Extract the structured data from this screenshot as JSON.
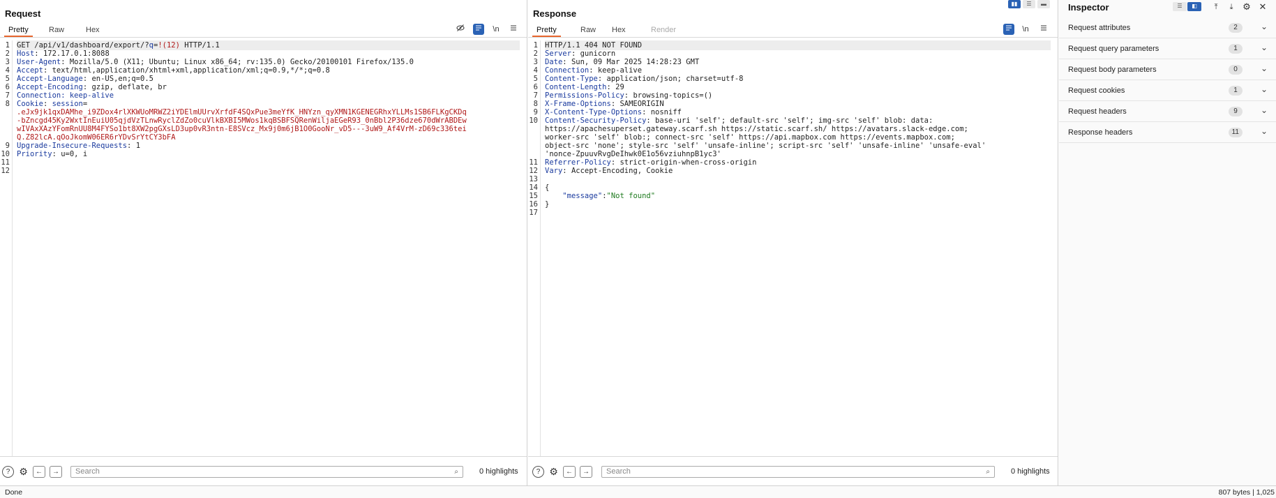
{
  "request": {
    "title": "Request",
    "tabs": [
      "Pretty",
      "Raw",
      "Hex"
    ],
    "tools": {
      "hide": "👁",
      "wrap": "≡",
      "newline": "\\n",
      "menu": "≡"
    },
    "lines": [
      {
        "n": "1",
        "parts": [
          {
            "t": "GET /api/v1/dashboard/export/?",
            "c": ""
          },
          {
            "t": "q",
            "c": "k"
          },
          {
            "t": "=",
            "c": ""
          },
          {
            "t": "!(12)",
            "c": "red"
          },
          {
            "t": " HTTP/1.1",
            "c": ""
          }
        ]
      },
      {
        "n": "2",
        "parts": [
          {
            "t": "Host",
            "c": "k"
          },
          {
            "t": ": 172.17.0.1:8088",
            "c": ""
          }
        ]
      },
      {
        "n": "3",
        "parts": [
          {
            "t": "User-Agent",
            "c": "k"
          },
          {
            "t": ": Mozilla/5.0 (X11; Ubuntu; Linux x86_64; rv:135.0) Gecko/20100101 Firefox/135.0",
            "c": ""
          }
        ]
      },
      {
        "n": "4",
        "parts": [
          {
            "t": "Accept",
            "c": "k"
          },
          {
            "t": ": text/html,application/xhtml+xml,application/xml;q=0.9,*/*;q=0.8",
            "c": ""
          }
        ]
      },
      {
        "n": "5",
        "parts": [
          {
            "t": "Accept-Language",
            "c": "k"
          },
          {
            "t": ": en-US,en;q=0.5",
            "c": ""
          }
        ]
      },
      {
        "n": "6",
        "parts": [
          {
            "t": "Accept-Encoding",
            "c": "k"
          },
          {
            "t": ": gzip, deflate, br",
            "c": ""
          }
        ]
      },
      {
        "n": "7",
        "parts": [
          {
            "t": "Connection: keep-alive",
            "c": "k"
          }
        ]
      },
      {
        "n": "8",
        "parts": [
          {
            "t": "Cookie",
            "c": "k"
          },
          {
            "t": ": ",
            "c": ""
          },
          {
            "t": "session",
            "c": "k"
          },
          {
            "t": "=",
            "c": ""
          }
        ]
      },
      {
        "n": "",
        "parts": [
          {
            "t": ".eJx9jk1qxDAMhe_i9ZDox4rlXKWUoMRWZ2iYDElmUUrvXrfdF4SQxPue3meYfK_HNYzn_qyXMN1KGENEGRhxYLLMs1SB6FLKgCKDq",
            "c": "red"
          }
        ]
      },
      {
        "n": "",
        "parts": [
          {
            "t": "-bZncgd45Ky2WxtInEuiU05qjdVzTLnwRyclZdZo0cuVlkBXBI5MWos1kqBSBFSQRenWiljaEGeR93_0nBbl2P36dze670dWrABDEw",
            "c": "red"
          }
        ]
      },
      {
        "n": "",
        "parts": [
          {
            "t": "wIVAxXAzYFomRnUU8M4FYSo1bt8XW2pgGXsLD3up0vR3ntn-E8SVcz_Mx9j0m6jB1O0GooNr_vD5---3uW9_Af4VrM-zD69c336tei",
            "c": "red"
          }
        ]
      },
      {
        "n": "",
        "parts": [
          {
            "t": "Q.Z82lcA.qOoJkomW06ER6rYDvSrYtCY3bFA",
            "c": "red"
          }
        ]
      },
      {
        "n": "9",
        "parts": [
          {
            "t": "Upgrade-Insecure-Requests",
            "c": "k"
          },
          {
            "t": ": 1",
            "c": ""
          }
        ]
      },
      {
        "n": "10",
        "parts": [
          {
            "t": "Priority",
            "c": "k"
          },
          {
            "t": ": u=0, i",
            "c": ""
          }
        ]
      },
      {
        "n": "11",
        "parts": []
      },
      {
        "n": "12",
        "parts": []
      }
    ],
    "search_placeholder": "Search",
    "highlights": "0 highlights"
  },
  "response": {
    "title": "Response",
    "tabs": [
      "Pretty",
      "Raw",
      "Hex",
      "Render"
    ],
    "lines": [
      {
        "n": "1",
        "parts": [
          {
            "t": "HTTP/1.1 404 NOT FOUND",
            "c": ""
          }
        ]
      },
      {
        "n": "2",
        "parts": [
          {
            "t": "Server",
            "c": "k"
          },
          {
            "t": ": gunicorn",
            "c": ""
          }
        ]
      },
      {
        "n": "3",
        "parts": [
          {
            "t": "Date",
            "c": "k"
          },
          {
            "t": ": Sun, 09 Mar 2025 14:28:23 GMT",
            "c": ""
          }
        ]
      },
      {
        "n": "4",
        "parts": [
          {
            "t": "Connection",
            "c": "k"
          },
          {
            "t": ": keep-alive",
            "c": ""
          }
        ]
      },
      {
        "n": "5",
        "parts": [
          {
            "t": "Content-Type",
            "c": "k"
          },
          {
            "t": ": application/json; charset=utf-8",
            "c": ""
          }
        ]
      },
      {
        "n": "6",
        "parts": [
          {
            "t": "Content-Length",
            "c": "k"
          },
          {
            "t": ": 29",
            "c": ""
          }
        ]
      },
      {
        "n": "7",
        "parts": [
          {
            "t": "Permissions-Policy",
            "c": "k"
          },
          {
            "t": ": browsing-topics=()",
            "c": ""
          }
        ]
      },
      {
        "n": "8",
        "parts": [
          {
            "t": "X-Frame-Options",
            "c": "k"
          },
          {
            "t": ": SAMEORIGIN",
            "c": ""
          }
        ]
      },
      {
        "n": "9",
        "parts": [
          {
            "t": "X-Content-Type-Options",
            "c": "k"
          },
          {
            "t": ": nosniff",
            "c": ""
          }
        ]
      },
      {
        "n": "10",
        "parts": [
          {
            "t": "Content-Security-Policy",
            "c": "k"
          },
          {
            "t": ": base-uri 'self'; default-src 'self'; img-src 'self' blob: data:",
            "c": ""
          }
        ]
      },
      {
        "n": "",
        "parts": [
          {
            "t": "https://apachesuperset.gateway.scarf.sh https://static.scarf.sh/ https://avatars.slack-edge.com;",
            "c": ""
          }
        ]
      },
      {
        "n": "",
        "parts": [
          {
            "t": "worker-src 'self' blob:; connect-src 'self' https://api.mapbox.com https://events.mapbox.com;",
            "c": ""
          }
        ]
      },
      {
        "n": "",
        "parts": [
          {
            "t": "object-src 'none'; style-src 'self' 'unsafe-inline'; script-src 'self' 'unsafe-inline' 'unsafe-eval'",
            "c": ""
          }
        ]
      },
      {
        "n": "",
        "parts": [
          {
            "t": "'nonce-ZpuuvRvgDeIhwk0E1o56vziuhnpB1yc3'",
            "c": ""
          }
        ]
      },
      {
        "n": "11",
        "parts": [
          {
            "t": "Referrer-Policy",
            "c": "k"
          },
          {
            "t": ": strict-origin-when-cross-origin",
            "c": ""
          }
        ]
      },
      {
        "n": "12",
        "parts": [
          {
            "t": "Vary",
            "c": "k"
          },
          {
            "t": ": Accept-Encoding, Cookie",
            "c": ""
          }
        ]
      },
      {
        "n": "13",
        "parts": []
      },
      {
        "n": "14",
        "parts": [
          {
            "t": "{",
            "c": ""
          }
        ]
      },
      {
        "n": "15",
        "parts": [
          {
            "t": "    ",
            "c": ""
          },
          {
            "t": "\"message\"",
            "c": "k"
          },
          {
            "t": ":",
            "c": ""
          },
          {
            "t": "\"Not found\"",
            "c": "str"
          }
        ]
      },
      {
        "n": "16",
        "parts": [
          {
            "t": "}",
            "c": ""
          }
        ]
      },
      {
        "n": "17",
        "parts": []
      }
    ],
    "search_placeholder": "Search",
    "highlights": "0 highlights"
  },
  "inspector": {
    "title": "Inspector",
    "sections": [
      {
        "label": "Request attributes",
        "count": "2"
      },
      {
        "label": "Request query parameters",
        "count": "1"
      },
      {
        "label": "Request body parameters",
        "count": "0"
      },
      {
        "label": "Request cookies",
        "count": "1"
      },
      {
        "label": "Request headers",
        "count": "9"
      },
      {
        "label": "Response headers",
        "count": "11"
      }
    ]
  },
  "status": {
    "left": "Done",
    "right": "807 bytes | 1,025"
  },
  "colors": {
    "accent": "#e8662e",
    "selected": "#2a62b5",
    "key": "#1a3a9e",
    "red": "#b01919",
    "string": "#1e7a1e"
  }
}
